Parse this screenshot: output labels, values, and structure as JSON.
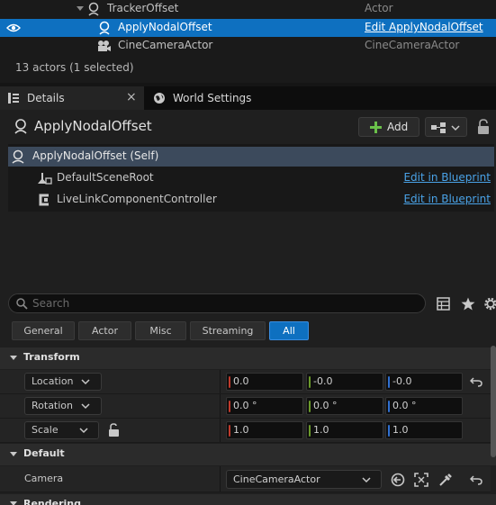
{
  "outliner": {
    "rows": [
      {
        "label": "TrackerOffset",
        "type": "Actor"
      },
      {
        "label": "ApplyNodalOffset",
        "type": "Edit ApplyNodalOffset"
      },
      {
        "label": "CineCameraActor",
        "type": "CineCameraActor"
      }
    ],
    "actor_count": "13 actors (1 selected)"
  },
  "tabs": [
    {
      "label": "Details",
      "close": "×"
    },
    {
      "label": "World Settings"
    }
  ],
  "details": {
    "actor_name": "ApplyNodalOffset",
    "add_label": "Add",
    "components": [
      {
        "label": "ApplyNodalOffset (Self)"
      },
      {
        "label": "DefaultSceneRoot",
        "edit": "Edit in Blueprint"
      },
      {
        "label": "LiveLinkComponentController",
        "edit": "Edit in Blueprint"
      }
    ],
    "search": {
      "placeholder": "Search"
    },
    "filters": [
      "General",
      "Actor",
      "Misc",
      "Streaming",
      "All"
    ],
    "active_filter": "All"
  },
  "sections": {
    "transform": "Transform",
    "default": "Default",
    "rendering": "Rendering"
  },
  "transform": {
    "rows": [
      {
        "label": "Location",
        "x": "0.0",
        "y": "-0.0",
        "z": "-0.0"
      },
      {
        "label": "Rotation",
        "x": "0.0 °",
        "y": "0.0 °",
        "z": "0.0 °"
      },
      {
        "label": "Scale",
        "x": "1.0",
        "y": "1.0",
        "z": "1.0"
      }
    ]
  },
  "default": {
    "camera_label": "Camera",
    "camera_value": "CineCameraActor"
  },
  "colors": {
    "selection": "#0e70c0",
    "axis_x": "#c0392b",
    "axis_y": "#6a9a2a",
    "axis_z": "#2f6fd0",
    "link": "#4aa3e8",
    "add_plus": "#6ac04a"
  },
  "icons": [
    "eye-icon",
    "actor-icon",
    "camera-icon",
    "globe-icon",
    "lock-icon",
    "plus-icon",
    "blueprint-icon",
    "search-icon",
    "table-icon",
    "star-icon",
    "gear-icon",
    "reset-arrow-icon",
    "eyedropper-icon"
  ]
}
